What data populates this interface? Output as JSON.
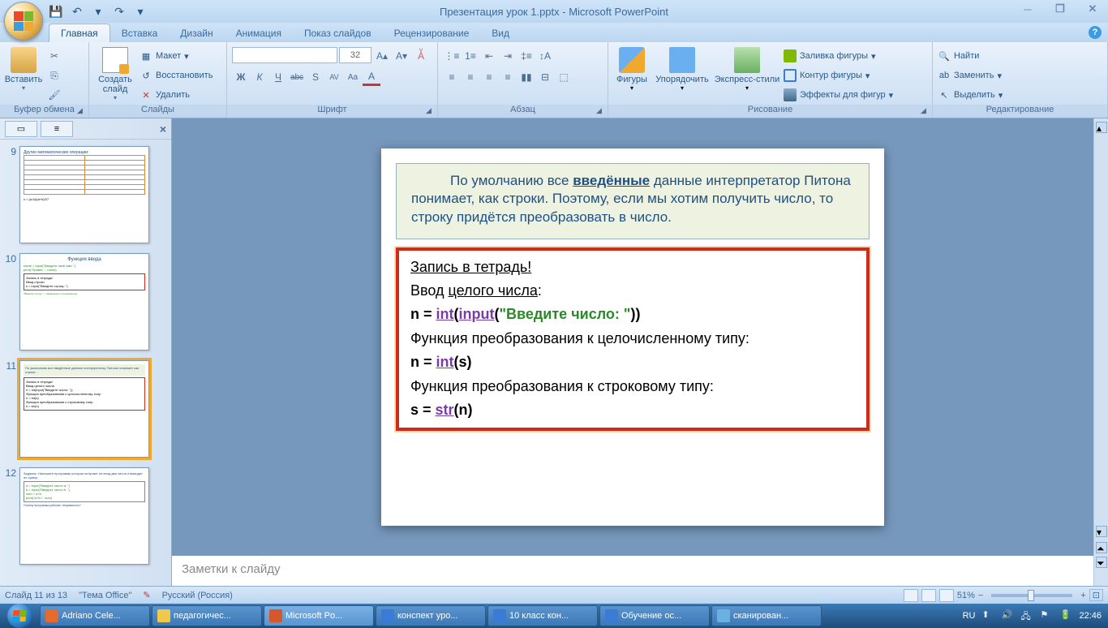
{
  "title": "Презентация урок 1.pptx - Microsoft PowerPoint",
  "qat": {
    "save": "💾",
    "undo": "↶",
    "redo": "↷",
    "drop": "▾"
  },
  "tabs": [
    "Главная",
    "Вставка",
    "Дизайн",
    "Анимация",
    "Показ слайдов",
    "Рецензирование",
    "Вид"
  ],
  "ribbon": {
    "clipboard": {
      "label": "Буфер обмена",
      "paste": "Вставить"
    },
    "slides": {
      "label": "Слайды",
      "new": "Создать слайд",
      "layout": "Макет",
      "reset": "Восстановить",
      "delete": "Удалить"
    },
    "font": {
      "label": "Шрифт",
      "size": "32",
      "bold": "Ж",
      "italic": "К",
      "under": "Ч",
      "strike": "abc",
      "shadow": "S",
      "spacing": "AV",
      "case": "Aa",
      "color": "A"
    },
    "para": {
      "label": "Абзац"
    },
    "draw": {
      "label": "Рисование",
      "shapes": "Фигуры",
      "arrange": "Упорядочить",
      "quick": "Экспресс-стили",
      "fill": "Заливка фигуры",
      "outline": "Контур фигуры",
      "effects": "Эффекты для фигур"
    },
    "edit": {
      "label": "Редактирование",
      "find": "Найти",
      "replace": "Заменить",
      "select": "Выделить"
    }
  },
  "thumbs": [
    {
      "n": "9"
    },
    {
      "n": "10"
    },
    {
      "n": "11"
    },
    {
      "n": "12"
    }
  ],
  "slide": {
    "top": "По умолчанию все введённые данные интерпретатор Питона понимает, как строки. Поэтому, если мы хотим получить число, то строку придётся преобразовать в число.",
    "top_link": "введённые",
    "notebook": "Запись в тетрадь!",
    "l1": "Ввод целого числа:",
    "c1a": "n = ",
    "c1b": "int",
    "c1c": "(",
    "c1d": "input",
    "c1e": "(",
    "c1f": "\"Введите число: \"",
    "c1g": "))",
    "l2": "Функция преобразования к целочисленному типу:",
    "c2a": "n = ",
    "c2b": "int",
    "c2c": "(s)",
    "l3": "Функция преобразования к строковому типу:",
    "c3a": "s = ",
    "c3b": "str",
    "c3c": "(n)"
  },
  "notes": "Заметки к слайду",
  "status": {
    "slide": "Слайд 11 из 13",
    "theme": "\"Тема Office\"",
    "lang": "Русский (Россия)",
    "zoom": "51%"
  },
  "taskbar": [
    {
      "icon": "#e66a2c",
      "label": "Adriano Cele..."
    },
    {
      "icon": "#f0c94a",
      "label": "педагогичес..."
    },
    {
      "icon": "#d6582a",
      "label": "Microsoft Po...",
      "active": true
    },
    {
      "icon": "#3a7bd5",
      "label": "конспект уро..."
    },
    {
      "icon": "#3a7bd5",
      "label": "10 класс кон..."
    },
    {
      "icon": "#3a7bd5",
      "label": "Обучение ос..."
    },
    {
      "icon": "#6ab0e0",
      "label": "сканирован..."
    }
  ],
  "tray": {
    "lang": "RU",
    "time": "22:46"
  }
}
